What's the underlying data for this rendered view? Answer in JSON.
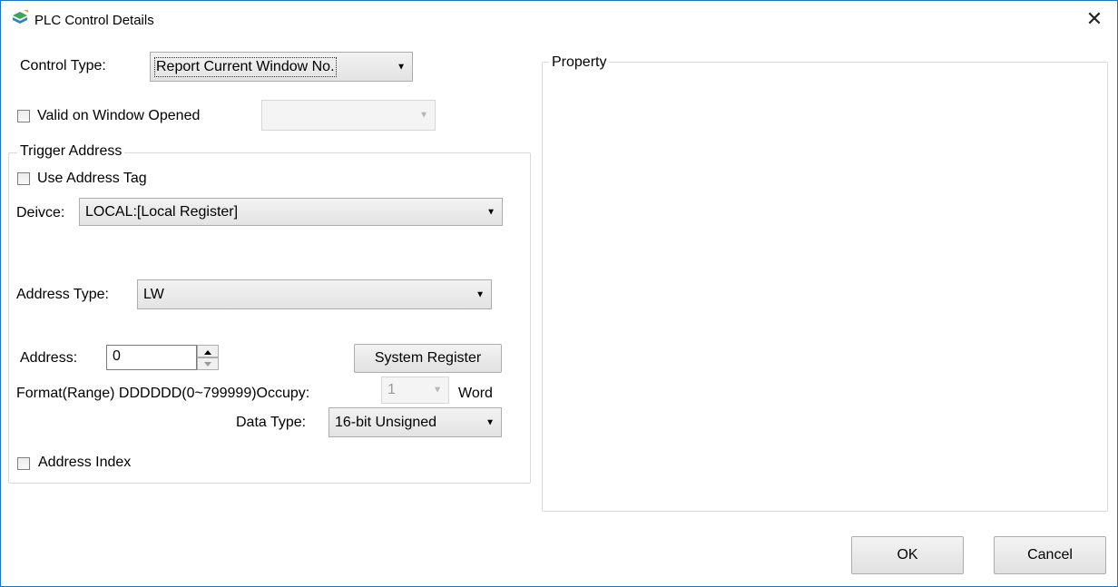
{
  "window": {
    "title": "PLC Control Details",
    "app_icon": "app-icon",
    "close_glyph": "✕"
  },
  "control_type": {
    "label": "Control Type:",
    "value": "Report Current Window No."
  },
  "valid_on_window_opened": {
    "label": "Valid on Window Opened",
    "checked": false,
    "combo_value": ""
  },
  "trigger_address": {
    "legend": "Trigger Address",
    "use_address_tag": {
      "label": "Use Address Tag",
      "checked": false
    },
    "device": {
      "label": "Deivce:",
      "value": "LOCAL:[Local Register]"
    },
    "address_type": {
      "label": "Address Type:",
      "value": "LW"
    },
    "address": {
      "label": "Address:",
      "value": "0"
    },
    "system_register_button": "System Register",
    "format_range": "Format(Range) DDDDDD(0~799999)Occupy:",
    "occupy": {
      "value": "1",
      "unit": "Word"
    },
    "data_type": {
      "label": "Data Type:",
      "value": "16-bit Unsigned"
    },
    "address_index": {
      "label": "Address Index",
      "checked": false
    }
  },
  "property": {
    "legend": "Property"
  },
  "buttons": {
    "ok": "OK",
    "cancel": "Cancel"
  },
  "colors": {
    "window_border": "#1e73be",
    "groupbox_border": "#d9d9d9",
    "button_border": "#adadad"
  }
}
